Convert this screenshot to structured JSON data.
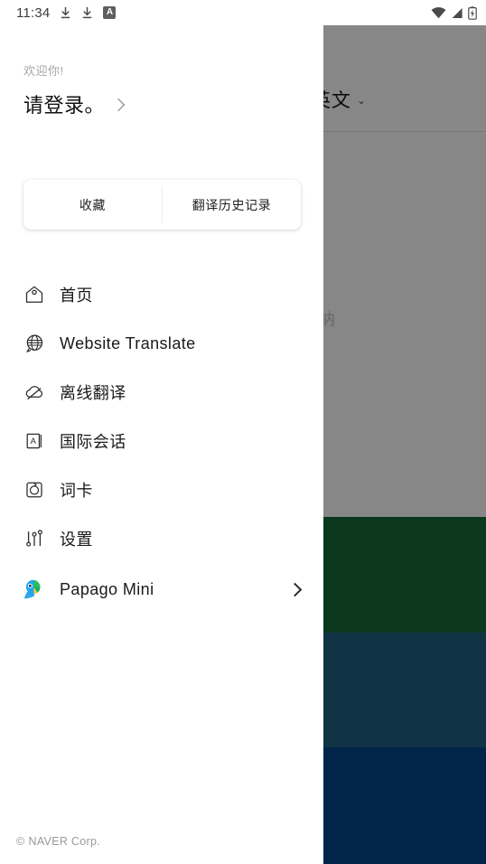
{
  "status_bar": {
    "time": "11:34",
    "left_icons": [
      "download-icon",
      "download-icon",
      "a-badge-icon"
    ],
    "a_badge_text": "A",
    "right_icons": [
      "wifi-icon",
      "cellular-signal-icon",
      "battery-charging-icon"
    ]
  },
  "background": {
    "language_selector": "英文",
    "language_chevron": "⌄",
    "ghost_text": "纳",
    "blocks": [
      {
        "name": "green-block",
        "color": "#166B35"
      },
      {
        "name": "teal-block",
        "color": "#1E5F82"
      },
      {
        "name": "navy-block",
        "color": "#00458C"
      }
    ]
  },
  "drawer": {
    "greeting": {
      "welcome": "欢迎你!",
      "login_prompt": "请登录。",
      "chevron": "chevron-right-icon"
    },
    "quick_actions": [
      {
        "label": "收藏",
        "name": "favorites-button"
      },
      {
        "label": "翻译历史记录",
        "name": "translation-history-button"
      }
    ],
    "menu": [
      {
        "label": "首页",
        "icon": "home-icon"
      },
      {
        "label": "Website Translate",
        "icon": "globe-translate-icon"
      },
      {
        "label": "离线翻译",
        "icon": "cloud-off-icon"
      },
      {
        "label": "国际会话",
        "icon": "phrasebook-icon"
      },
      {
        "label": "词卡",
        "icon": "word-card-icon"
      },
      {
        "label": "设置",
        "icon": "settings-sliders-icon"
      },
      {
        "label": "Papago Mini",
        "icon": "papago-parrot-icon",
        "chevron": "chevron-right-icon"
      }
    ],
    "footer": {
      "copyright_symbol": "©",
      "text": "NAVER Corp."
    }
  },
  "colors": {
    "accent_blue": "#00C3D7",
    "text_primary": "#1a1a1a",
    "text_muted": "#a6a6a6",
    "scrim": "rgba(0,0,0,0.47)"
  }
}
